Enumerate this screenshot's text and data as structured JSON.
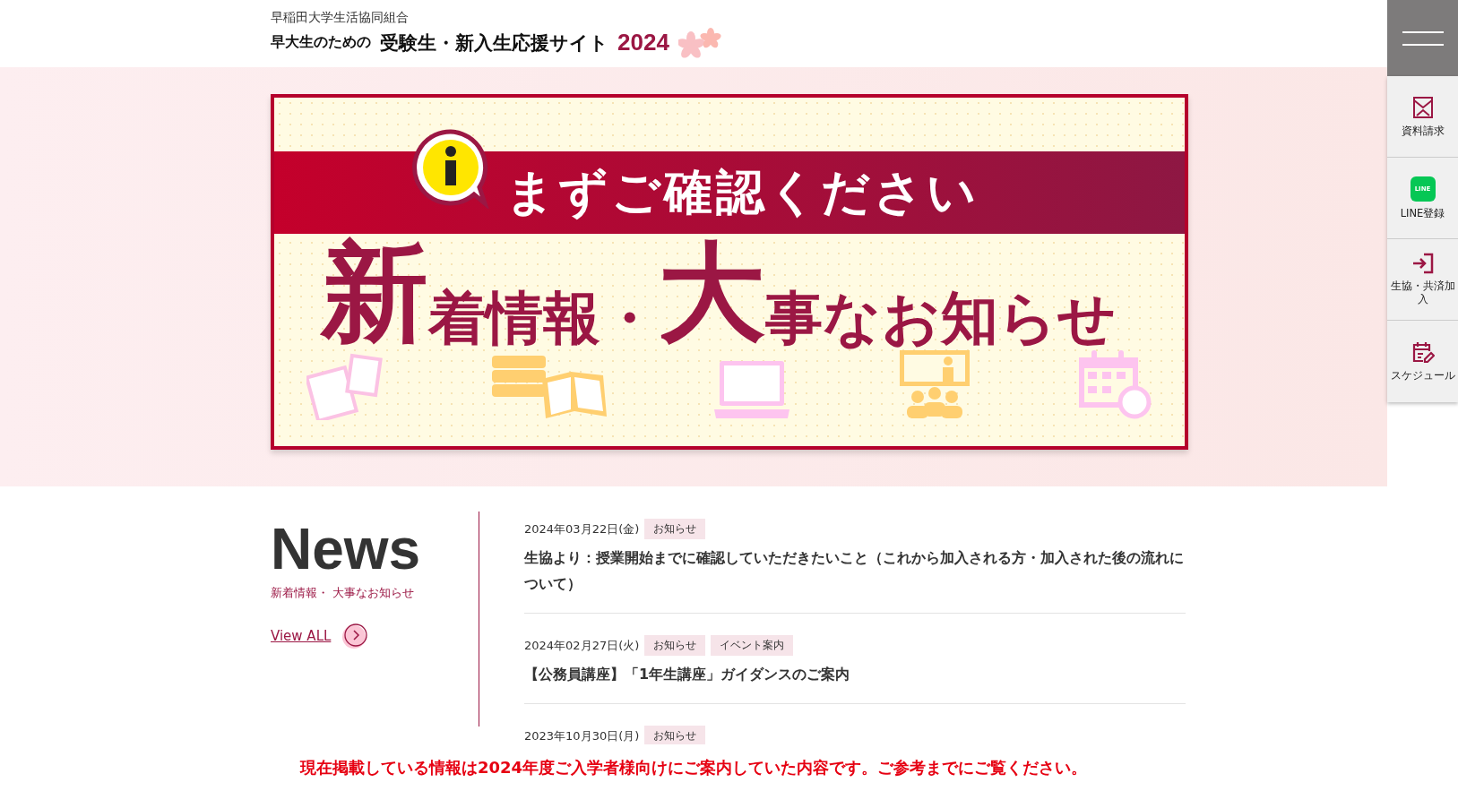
{
  "header": {
    "org": "早稲田大学生活協同組合",
    "prefix": "早大生のための",
    "site_title": "受験生・新入生応援サイト",
    "year": "2024"
  },
  "side_nav": {
    "items": [
      {
        "kind": "document",
        "label": "資料請求"
      },
      {
        "kind": "line",
        "label": "LINE登録",
        "badge": "LINE"
      },
      {
        "kind": "join",
        "label": "生協・共済加入"
      },
      {
        "kind": "schedule",
        "label": "スケジュール"
      }
    ]
  },
  "banner": {
    "ribbon": "まずご確認ください",
    "headline": [
      {
        "text": "新",
        "kind": "large"
      },
      {
        "text": "着情報・",
        "kind": "normal"
      },
      {
        "text": "大",
        "kind": "large"
      },
      {
        "text": "事なお知らせ",
        "kind": "normal"
      }
    ]
  },
  "news": {
    "heading": "News",
    "subheading": "新着情報・ 大事なお知らせ",
    "view_all": "View ALL",
    "items": [
      {
        "date": "2024年03月22日(金)",
        "tags": [
          "お知らせ"
        ],
        "title": "生協より：授業開始までに確認していただきたいこと（これから加入される方・加入された後の流れについて）"
      },
      {
        "date": "2024年02月27日(火)",
        "tags": [
          "お知らせ",
          "イベント案内"
        ],
        "title": "【公務員講座】「1年生講座」ガイダンスのご案内"
      },
      {
        "date": "2023年10月30日(月)",
        "tags": [
          "お知らせ"
        ]
      }
    ]
  },
  "notice": "現在掲載している情報は2024年度ご入学者様向けにご案内していた内容です。ご参考までにご覧ください。"
}
